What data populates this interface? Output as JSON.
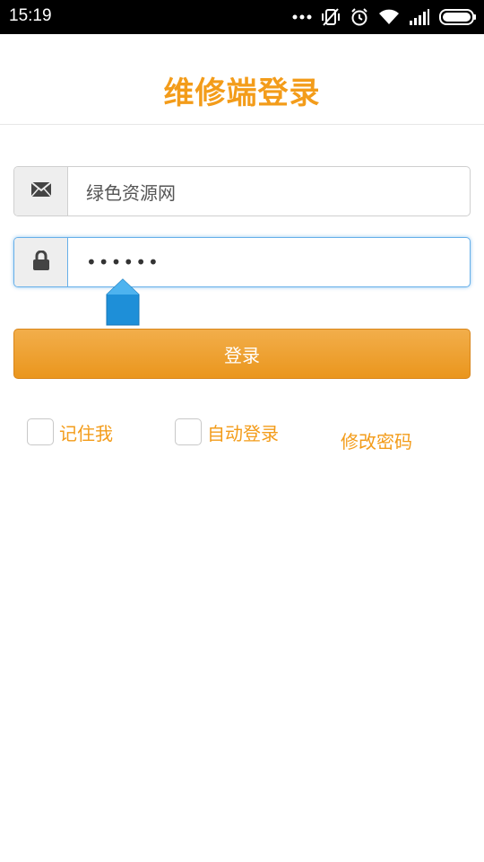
{
  "status_bar": {
    "time": "15:19",
    "icons": [
      "more-dots-icon",
      "vibrate-off-icon",
      "alarm-icon",
      "wifi-icon",
      "signal-icon",
      "battery-icon"
    ]
  },
  "header": {
    "title": "维修端登录"
  },
  "form": {
    "username": {
      "value": "绿色资源网",
      "icon": "mail-icon"
    },
    "password": {
      "value": "••••••",
      "icon": "lock-icon"
    },
    "login_label": "登录",
    "remember_label": "记住我",
    "auto_login_label": "自动登录",
    "change_password_label": "修改密码"
  },
  "colors": {
    "accent": "#f39c1a",
    "button_top": "#f2ae4b",
    "button_bottom": "#ea961d",
    "focus_border": "#66afe9",
    "cursor_handle": "#1e8fd8"
  }
}
